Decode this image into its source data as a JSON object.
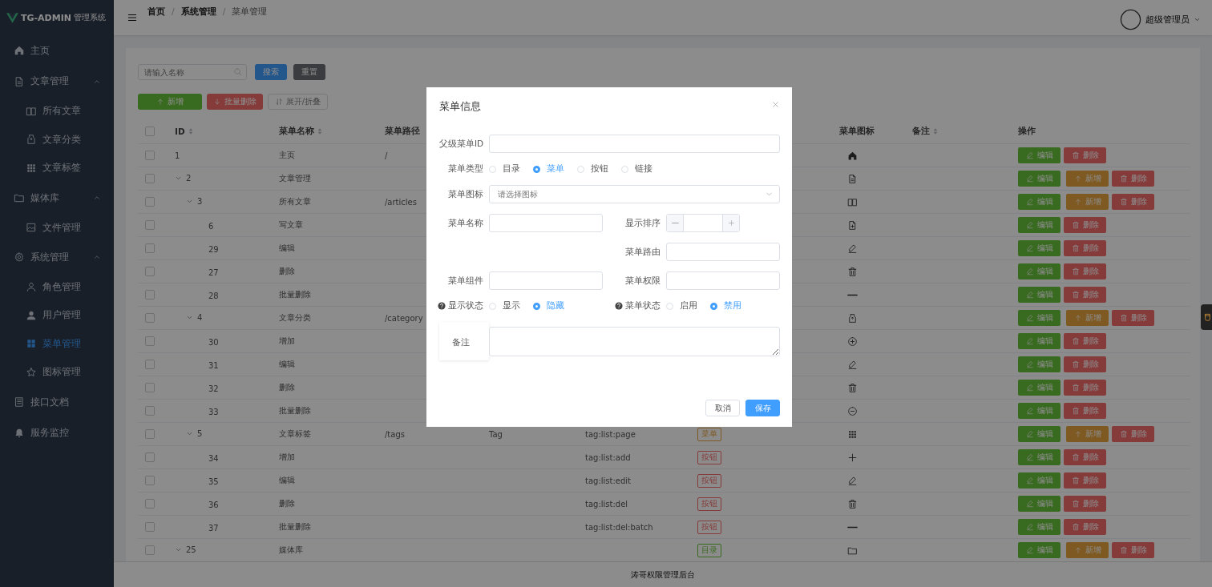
{
  "brand": {
    "title": "TG-ADMIN",
    "subtitle": "管理系统"
  },
  "sidebar": {
    "items": [
      {
        "label": "主页",
        "selected": false
      },
      {
        "label": "文章管理",
        "expanded": true,
        "children": [
          {
            "label": "所有文章",
            "selected": false
          },
          {
            "label": "文章分类",
            "selected": false
          },
          {
            "label": "文章标签",
            "selected": false
          }
        ]
      },
      {
        "label": "媒体库",
        "expanded": true,
        "children": [
          {
            "label": "文件管理",
            "selected": false
          }
        ]
      },
      {
        "label": "系统管理",
        "expanded": true,
        "children": [
          {
            "label": "角色管理",
            "selected": false
          },
          {
            "label": "用户管理",
            "selected": false
          },
          {
            "label": "菜单管理",
            "selected": true
          },
          {
            "label": "图标管理",
            "selected": false
          }
        ]
      },
      {
        "label": "接口文档",
        "selected": false
      },
      {
        "label": "服务监控",
        "selected": false
      }
    ]
  },
  "breadcrumb": {
    "separator": "/",
    "items": [
      "首页",
      "系统管理",
      "菜单管理"
    ]
  },
  "user": {
    "name": "超级管理员"
  },
  "toolbar": {
    "search": {
      "placeholder": "请输入名称"
    },
    "buttons": [
      {
        "label": "搜索",
        "kind": "primary"
      },
      {
        "label": "重置",
        "kind": "info"
      }
    ],
    "actions": [
      {
        "label": "新增",
        "kind": "success"
      },
      {
        "label": "批量删除",
        "kind": "danger"
      },
      {
        "label": "展开/折叠",
        "kind": "plain"
      }
    ]
  },
  "table": {
    "all_checked": false,
    "columns": [
      {
        "label": "ID",
        "sortable": true
      },
      {
        "label": "菜单名称",
        "sortable": true
      },
      {
        "label": "菜单路径",
        "sortable": false
      },
      {
        "label": "菜单图标",
        "sortable": false
      },
      {
        "label": "备注",
        "sortable": true
      },
      {
        "label": "操作",
        "sortable": false
      }
    ],
    "rows": [
      {
        "id": "1",
        "name": "主页",
        "path": "/",
        "checked": false,
        "actions": [
          {
            "kind": "edit",
            "label": "编辑"
          },
          {
            "kind": "delete",
            "label": "删除"
          }
        ]
      },
      {
        "id": "2",
        "name": "文章管理",
        "checked": false,
        "expanded": true,
        "actions": [
          {
            "kind": "edit",
            "label": "编辑"
          },
          {
            "kind": "add",
            "label": "新增"
          },
          {
            "kind": "delete",
            "label": "删除"
          }
        ],
        "children": [
          {
            "id": "3",
            "name": "所有文章",
            "path": "/articles",
            "checked": false,
            "expanded": true,
            "actions": [
              {
                "kind": "edit",
                "label": "编辑"
              },
              {
                "kind": "add",
                "label": "新增"
              },
              {
                "kind": "delete",
                "label": "删除"
              }
            ],
            "children": [
              {
                "id": "6",
                "name": "写文章",
                "checked": false,
                "actions": [
                  {
                    "kind": "edit",
                    "label": "编辑"
                  },
                  {
                    "kind": "delete",
                    "label": "删除"
                  }
                ]
              },
              {
                "id": "29",
                "name": "编辑",
                "checked": false,
                "actions": [
                  {
                    "kind": "edit",
                    "label": "编辑"
                  },
                  {
                    "kind": "delete",
                    "label": "删除"
                  }
                ]
              },
              {
                "id": "27",
                "name": "删除",
                "checked": false,
                "actions": [
                  {
                    "kind": "edit",
                    "label": "编辑"
                  },
                  {
                    "kind": "delete",
                    "label": "删除"
                  }
                ]
              },
              {
                "id": "28",
                "name": "批量删除",
                "checked": false,
                "actions": [
                  {
                    "kind": "edit",
                    "label": "编辑"
                  },
                  {
                    "kind": "delete",
                    "label": "删除"
                  }
                ]
              }
            ]
          },
          {
            "id": "4",
            "name": "文章分类",
            "path": "/category",
            "checked": false,
            "expanded": true,
            "actions": [
              {
                "kind": "edit",
                "label": "编辑"
              },
              {
                "kind": "add",
                "label": "新增"
              },
              {
                "kind": "delete",
                "label": "删除"
              }
            ],
            "children": [
              {
                "id": "30",
                "name": "增加",
                "checked": false,
                "actions": [
                  {
                    "kind": "edit",
                    "label": "编辑"
                  },
                  {
                    "kind": "delete",
                    "label": "删除"
                  }
                ]
              },
              {
                "id": "31",
                "name": "编辑",
                "checked": false,
                "actions": [
                  {
                    "kind": "edit",
                    "label": "编辑"
                  },
                  {
                    "kind": "delete",
                    "label": "删除"
                  }
                ]
              },
              {
                "id": "32",
                "name": "删除",
                "checked": false,
                "actions": [
                  {
                    "kind": "edit",
                    "label": "编辑"
                  },
                  {
                    "kind": "delete",
                    "label": "删除"
                  }
                ]
              },
              {
                "id": "33",
                "name": "批量删除",
                "checked": false,
                "actions": [
                  {
                    "kind": "edit",
                    "label": "编辑"
                  },
                  {
                    "kind": "delete",
                    "label": "删除"
                  }
                ]
              }
            ]
          },
          {
            "id": "5",
            "name": "文章标签",
            "path": "/tags",
            "component": "Tag",
            "permission": "tag:list:page",
            "type": {
              "label": "菜单",
              "color": "#7e5921"
            },
            "checked": false,
            "expanded": true,
            "actions": [
              {
                "kind": "edit",
                "label": "编辑"
              },
              {
                "kind": "add",
                "label": "新增"
              },
              {
                "kind": "delete",
                "label": "删除"
              }
            ],
            "children": [
              {
                "id": "34",
                "name": "增加",
                "permission": "tag:list:add",
                "type": {
                  "label": "按钮",
                  "color": "#863b3b"
                },
                "checked": false,
                "actions": [
                  {
                    "kind": "edit",
                    "label": "编辑"
                  },
                  {
                    "kind": "delete",
                    "label": "删除"
                  }
                ]
              },
              {
                "id": "35",
                "name": "编辑",
                "permission": "tag:list:edit",
                "type": {
                  "label": "按钮",
                  "color": "#863b3b"
                },
                "checked": false,
                "actions": [
                  {
                    "kind": "edit",
                    "label": "编辑"
                  },
                  {
                    "kind": "delete",
                    "label": "删除"
                  }
                ]
              },
              {
                "id": "36",
                "name": "删除",
                "permission": "tag:list:del",
                "type": {
                  "label": "按钮",
                  "color": "#863b3b"
                },
                "checked": false,
                "actions": [
                  {
                    "kind": "edit",
                    "label": "编辑"
                  },
                  {
                    "kind": "delete",
                    "label": "删除"
                  }
                ]
              },
              {
                "id": "37",
                "name": "批量删除",
                "permission": "tag:list:del:batch",
                "type": {
                  "label": "按钮",
                  "color": "#863b3b"
                },
                "checked": false,
                "actions": [
                  {
                    "kind": "edit",
                    "label": "编辑"
                  },
                  {
                    "kind": "delete",
                    "label": "删除"
                  }
                ]
              }
            ]
          }
        ]
      },
      {
        "id": "25",
        "name": "媒体库",
        "type": {
          "label": "目录",
          "color": "#396a20"
        },
        "checked": false,
        "expanded": true,
        "actions": [
          {
            "kind": "edit",
            "label": "编辑"
          },
          {
            "kind": "add",
            "label": "新增"
          },
          {
            "kind": "delete",
            "label": "删除"
          }
        ]
      }
    ]
  },
  "footer": "涛哥权限管理后台",
  "dialog": {
    "title": "菜单信息",
    "parent_id": {
      "label": "父级菜单ID"
    },
    "menu_type": {
      "label": "菜单类型",
      "options": [
        {
          "label": "目录",
          "selected": false
        },
        {
          "label": "菜单",
          "selected": true
        },
        {
          "label": "按钮",
          "selected": false
        },
        {
          "label": "链接",
          "selected": false
        }
      ]
    },
    "menu_icon": {
      "label": "菜单图标",
      "placeholder": "请选择图标"
    },
    "menu_name": {
      "label": "菜单名称"
    },
    "sort_order": {
      "label": "显示排序"
    },
    "route": {
      "label": "菜单路由"
    },
    "component": {
      "label": "菜单组件"
    },
    "permission": {
      "label": "菜单权限"
    },
    "visible": {
      "label": "显示状态",
      "options": [
        {
          "label": "显示",
          "selected": false
        },
        {
          "label": "隐藏",
          "selected": true
        }
      ]
    },
    "status": {
      "label": "菜单状态",
      "options": [
        {
          "label": "启用",
          "selected": false
        },
        {
          "label": "禁用",
          "selected": true
        }
      ]
    },
    "remark": {
      "label": "备注"
    },
    "buttons": [
      {
        "label": "取消",
        "kind": "default"
      },
      {
        "label": "保存",
        "kind": "primary"
      }
    ]
  }
}
